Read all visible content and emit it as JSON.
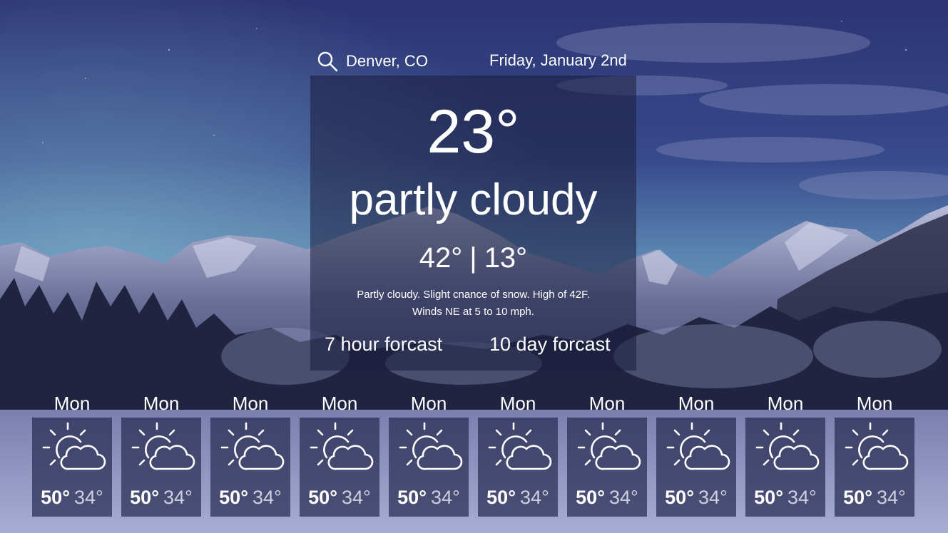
{
  "header": {
    "location": "Denver, CO",
    "date": "Friday, January 2nd",
    "search_icon": "search-icon"
  },
  "current": {
    "temperature": "23°",
    "condition": "partly cloudy",
    "high": "42°",
    "separator": "|",
    "low": "13°",
    "description_line1": "Partly cloudy. Slight cnance of snow. High of 42F.",
    "description_line2": "Winds NE at 5 to 10 mph."
  },
  "links": {
    "hourly": "7 hour forcast",
    "daily": "10 day forcast"
  },
  "forecast": [
    {
      "day": "Mon",
      "high": "50°",
      "low": "34°",
      "icon": "partly-cloudy-icon"
    },
    {
      "day": "Mon",
      "high": "50°",
      "low": "34°",
      "icon": "partly-cloudy-icon"
    },
    {
      "day": "Mon",
      "high": "50°",
      "low": "34°",
      "icon": "partly-cloudy-icon"
    },
    {
      "day": "Mon",
      "high": "50°",
      "low": "34°",
      "icon": "partly-cloudy-icon"
    },
    {
      "day": "Mon",
      "high": "50°",
      "low": "34°",
      "icon": "partly-cloudy-icon"
    },
    {
      "day": "Mon",
      "high": "50°",
      "low": "34°",
      "icon": "partly-cloudy-icon"
    },
    {
      "day": "Mon",
      "high": "50°",
      "low": "34°",
      "icon": "partly-cloudy-icon"
    },
    {
      "day": "Mon",
      "high": "50°",
      "low": "34°",
      "icon": "partly-cloudy-icon"
    },
    {
      "day": "Mon",
      "high": "50°",
      "low": "34°",
      "icon": "partly-cloudy-icon"
    },
    {
      "day": "Mon",
      "high": "50°",
      "low": "34°",
      "icon": "partly-cloudy-icon"
    }
  ],
  "colors": {
    "sky_top": "#2f3a7a",
    "sky_horizon": "#5c8fb6",
    "mountain": "#4a5078",
    "snow": "#c9cbe6",
    "trees": "#1d2038",
    "panel": "#1b1e3e",
    "text": "#ffffff"
  }
}
